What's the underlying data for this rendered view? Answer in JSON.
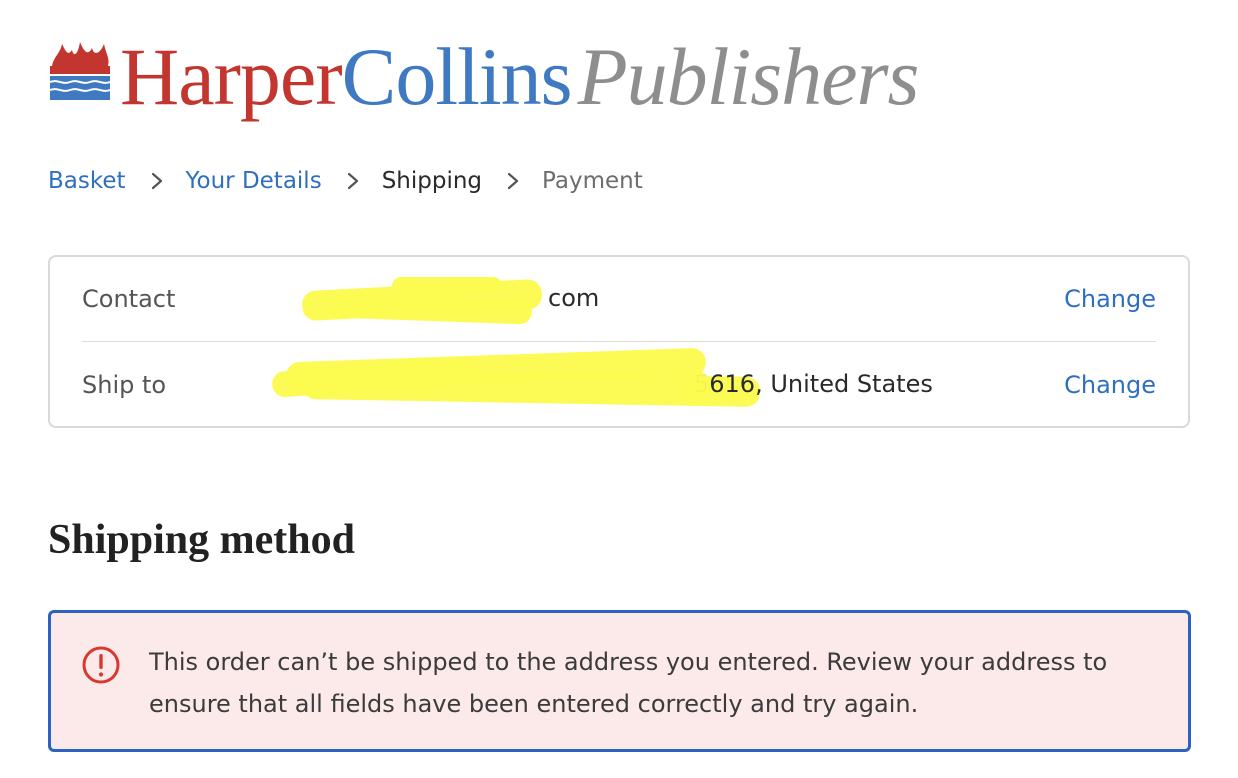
{
  "logo": {
    "harper": "Harper",
    "collins": "Collins",
    "publishers": "Publishers"
  },
  "breadcrumb": {
    "steps": [
      {
        "label": "Basket",
        "state": "link"
      },
      {
        "label": "Your Details",
        "state": "link"
      },
      {
        "label": "Shipping",
        "state": "current"
      },
      {
        "label": "Payment",
        "state": "future"
      }
    ]
  },
  "review": {
    "contact": {
      "label": "Contact",
      "value_visible": "com",
      "change_label": "Change"
    },
    "ship_to": {
      "label": "Ship to",
      "value_visible": "5616, United States",
      "change_label": "Change"
    }
  },
  "shipping_method": {
    "title": "Shipping method",
    "error": {
      "icon": "error-circle-icon",
      "message": "This order can’t be shipped to the address you entered. Review your address to ensure that all fields have been entered correctly and try again."
    }
  },
  "colors": {
    "link": "#2f6fbf",
    "brand_red": "#c2362f",
    "brand_blue": "#3f79c1",
    "alert_border": "#2a62c4",
    "alert_bg": "#fceaea",
    "error_icon": "#d8392f",
    "redaction": "#fcfb4f"
  }
}
